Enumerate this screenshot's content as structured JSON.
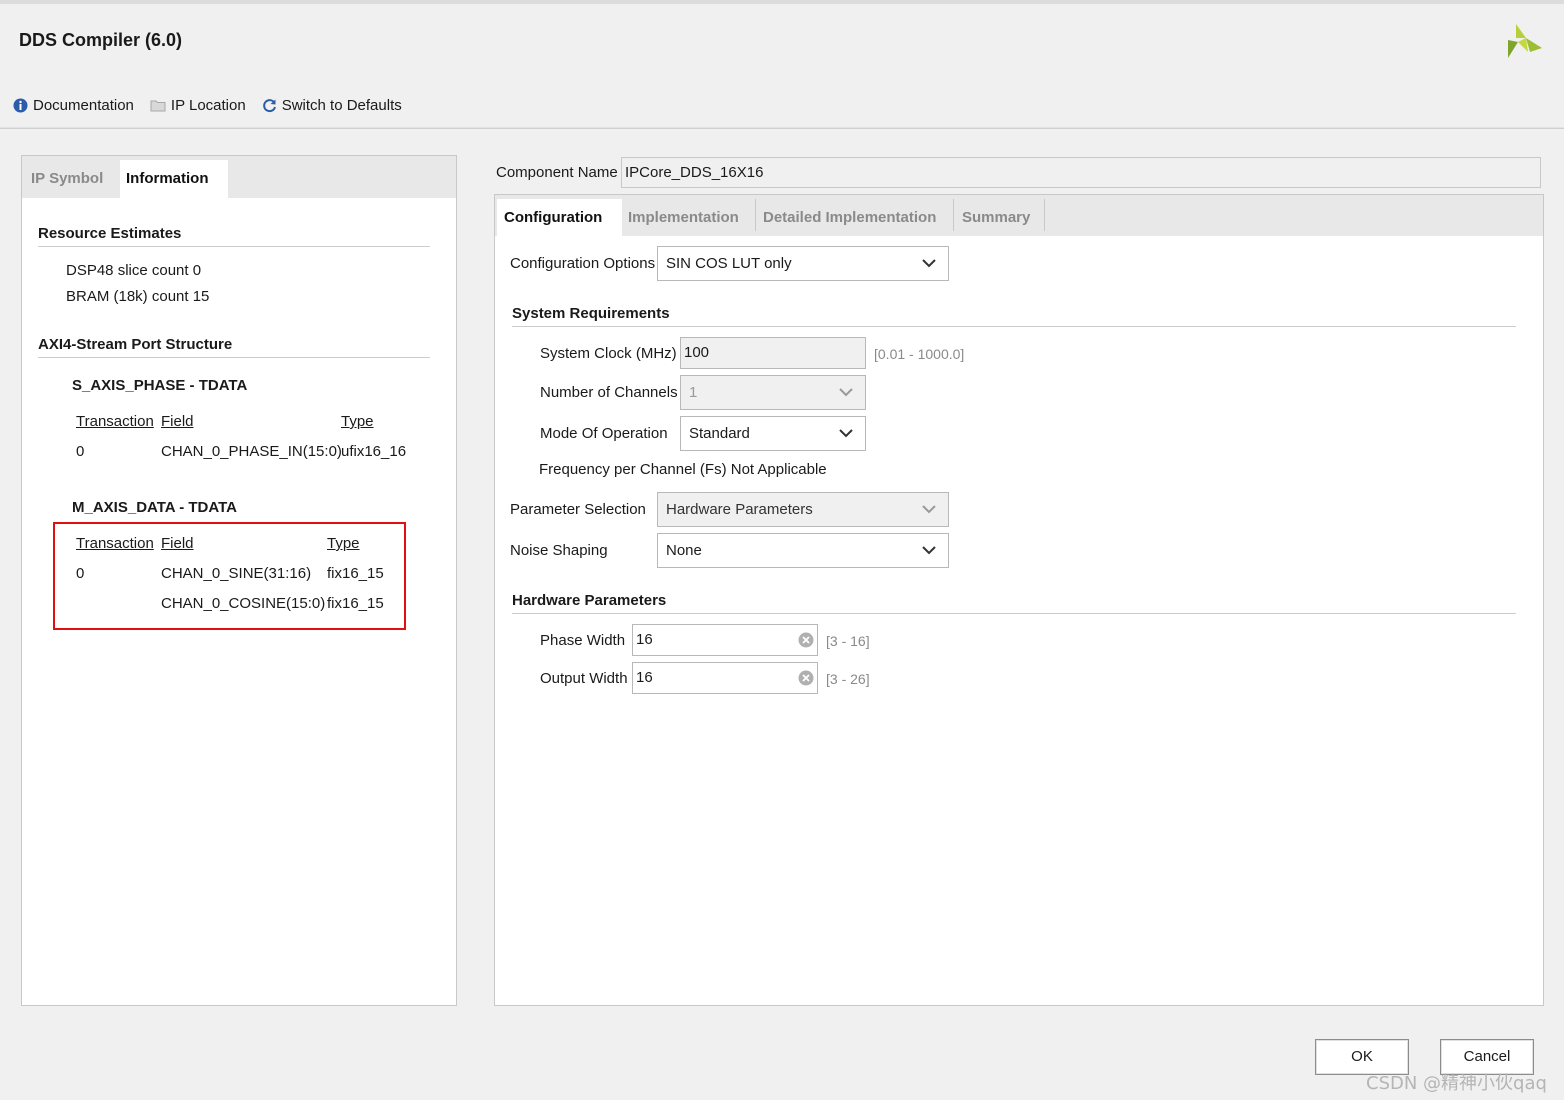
{
  "window": {
    "title": "DDS Compiler (6.0)"
  },
  "toolbar": {
    "documentation": "Documentation",
    "ip_location": "IP Location",
    "switch_defaults": "Switch to Defaults"
  },
  "left": {
    "tabs": [
      "IP Symbol",
      "Information"
    ],
    "active_tab": "Information",
    "resource_estimates": {
      "heading": "Resource Estimates",
      "dsp48": "DSP48 slice count 0",
      "bram": "BRAM (18k) count 15"
    },
    "port_structure": {
      "heading": "AXI4-Stream Port Structure",
      "s_axis": {
        "title": "S_AXIS_PHASE - TDATA",
        "headers": [
          "Transaction",
          "Field",
          "Type"
        ],
        "rows": [
          {
            "transaction": "0",
            "field": "CHAN_0_PHASE_IN(15:0)",
            "type": "ufix16_16"
          }
        ]
      },
      "m_axis": {
        "title": "M_AXIS_DATA - TDATA",
        "headers": [
          "Transaction",
          "Field",
          "Type"
        ],
        "rows": [
          {
            "transaction": "0",
            "field": "CHAN_0_SINE(31:16)",
            "type": "fix16_15"
          },
          {
            "transaction": "",
            "field": "CHAN_0_COSINE(15:0)",
            "type": "fix16_15"
          }
        ]
      }
    }
  },
  "component": {
    "label": "Component Name",
    "value": "IPCore_DDS_16X16"
  },
  "right": {
    "tabs": [
      "Configuration",
      "Implementation",
      "Detailed Implementation",
      "Summary"
    ],
    "active_tab": "Configuration",
    "config_options": {
      "label": "Configuration Options",
      "value": "SIN COS LUT only"
    },
    "system_requirements": {
      "heading": "System Requirements",
      "clock": {
        "label": "System Clock (MHz)",
        "value": "100",
        "range": "[0.01 - 1000.0]"
      },
      "channels": {
        "label": "Number of Channels",
        "value": "1"
      },
      "mode": {
        "label": "Mode Of Operation",
        "value": "Standard"
      },
      "freq": "Frequency per Channel (Fs) Not Applicable"
    },
    "param_selection": {
      "label": "Parameter Selection",
      "value": "Hardware Parameters"
    },
    "noise_shaping": {
      "label": "Noise Shaping",
      "value": "None"
    },
    "hardware_parameters": {
      "heading": "Hardware Parameters",
      "phase_width": {
        "label": "Phase Width",
        "value": "16",
        "range": "[3 - 16]"
      },
      "output_width": {
        "label": "Output Width",
        "value": "16",
        "range": "[3 - 26]"
      }
    }
  },
  "buttons": {
    "ok": "OK",
    "cancel": "Cancel"
  },
  "watermark": "CSDN @精神小伙qaq",
  "colors": {
    "logo_green": "#8db33a",
    "highlight_box": "#e01010",
    "info_icon": "#2a5caa"
  }
}
